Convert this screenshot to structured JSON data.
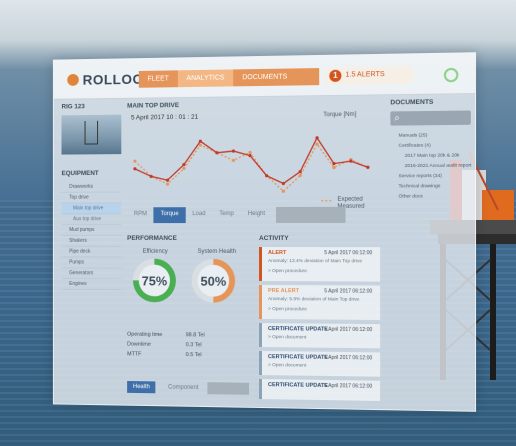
{
  "top_nav": {
    "logo": "ROLLOOS",
    "tabs": [
      "FLEET",
      "ANALYTICS",
      "DOCUMENTS"
    ],
    "active_tab": "ANALYTICS",
    "alert_count": "1",
    "alert_label": "1.5 ALERTS",
    "accent_color": "#e6955a"
  },
  "left": {
    "rig_title": "RIG 123",
    "equipment_title": "EQUIPMENT",
    "items": [
      "Drawworks",
      "Top drive",
      "Main top drive",
      "Aux top drive",
      "Mud pumps",
      "Shakers",
      "Pipe deck",
      "Pumps",
      "Generators",
      "Engines"
    ]
  },
  "main_chart": {
    "title": "MAIN TOP DRIVE",
    "datetime": "5 April 2017 10 : 01 : 21",
    "series_label": "Torque [Nm]",
    "legend_expected": "Expected",
    "legend_measured": "Measured"
  },
  "chart_tabs": [
    "RPM",
    "Torque",
    "Load",
    "Temp",
    "Height"
  ],
  "active_chart_tab": "Torque",
  "performance": {
    "title": "PERFORMANCE",
    "efficiency_label": "Efficiency",
    "efficiency_value": "75%",
    "health_label": "System Health",
    "health_value": "50%",
    "rows": [
      {
        "label": "Operating time",
        "value": "98.8 Tel"
      },
      {
        "label": "Downtime",
        "value": "0.3 Tel"
      },
      {
        "label": "MTTF",
        "value": "0.5 Tel"
      }
    ],
    "button_health": "Health",
    "button_component": "Component"
  },
  "activity": {
    "title": "ACTIVITY",
    "items": [
      {
        "type": "ALERT",
        "date": "5 April 2017 06:12:00",
        "text": "Anomaly: 13.4% deviation of Main Top drive",
        "link": "> Open procedure"
      },
      {
        "type": "PRE ALERT",
        "date": "5 April 2017 06:12:00",
        "text": "Anomaly: 5.9% deviation of Main Top drive",
        "link": "> Open procedure"
      },
      {
        "type": "CERTIFICATE UPDATE",
        "date": "5 April 2017 06:12:00",
        "text": "",
        "link": "> Open document"
      },
      {
        "type": "CERTIFICATE UPDATE",
        "date": "5 April 2017 06:12:00",
        "text": "",
        "link": "> Open document"
      },
      {
        "type": "CERTIFICATE UPDATE",
        "date": "5 April 2017 06:12:00",
        "text": "",
        "link": ""
      }
    ]
  },
  "documents": {
    "title": "DOCUMENTS",
    "items": [
      "Manuals (25)",
      "Certificates (4)",
      "2017 Main top 20k & 20k",
      "2016-2021 Annual audit report",
      "Service reports (34)",
      "Technical drawings",
      "Other docs"
    ]
  },
  "chart_data": {
    "type": "line",
    "x": [
      1,
      2,
      3,
      4,
      5,
      6,
      7,
      8,
      9,
      10,
      11,
      12,
      13,
      14,
      15
    ],
    "series": [
      {
        "name": "Expected",
        "values": [
          6,
          4,
          3,
          5,
          8,
          7,
          6,
          7,
          4,
          2,
          4,
          8,
          5,
          6,
          5
        ]
      },
      {
        "name": "Measured",
        "values": [
          5,
          4,
          3.5,
          5.5,
          8.5,
          7,
          7.2,
          6.6,
          4,
          3,
          4.5,
          8.8,
          5.5,
          5.8,
          5
        ]
      }
    ],
    "ylim": [
      0,
      10
    ],
    "grid": false,
    "legend": "bottom-right"
  }
}
